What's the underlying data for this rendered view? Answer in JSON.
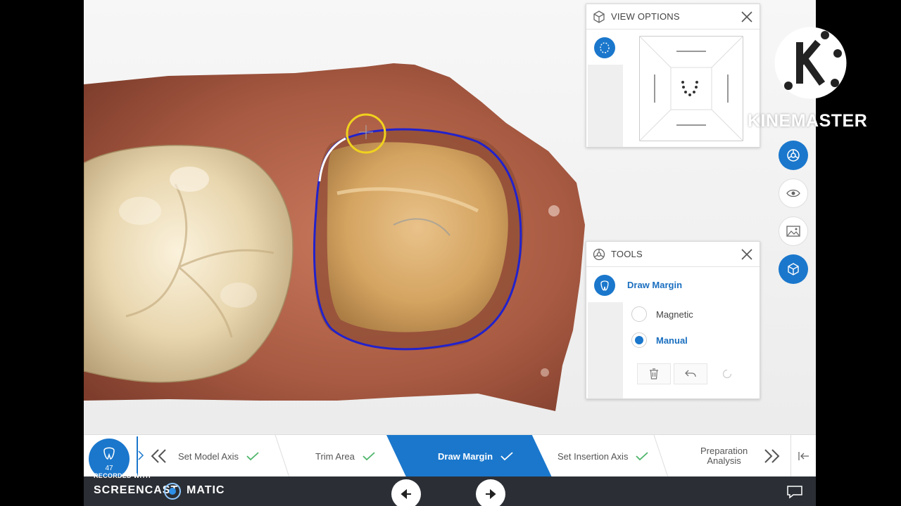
{
  "view_options": {
    "title": "VIEW OPTIONS"
  },
  "tools": {
    "title": "TOOLS",
    "active_tool": "Draw Margin",
    "modes": [
      {
        "label": "Magnetic",
        "selected": false
      },
      {
        "label": "Manual",
        "selected": true
      }
    ]
  },
  "case_badge": {
    "number": "47"
  },
  "workflow_steps": {
    "step1": "Set Model Axis",
    "step2": "Trim Area",
    "step3": "Draw Margin",
    "step4": "Set Insertion Axis",
    "step5_line1": "Preparation",
    "step5_line2": "Analysis"
  },
  "watermark": {
    "recorded_with": "RECORDED WITH",
    "brand_left": "SCREENCAST",
    "brand_right": "MATIC"
  },
  "overlay_logo": {
    "text": "KINEMASTER"
  },
  "colors": {
    "accent_blue": "#1a77cc",
    "margin_line": "#2222cc",
    "cursor_ring": "#f0d21e",
    "check_green": "#4db56a"
  }
}
